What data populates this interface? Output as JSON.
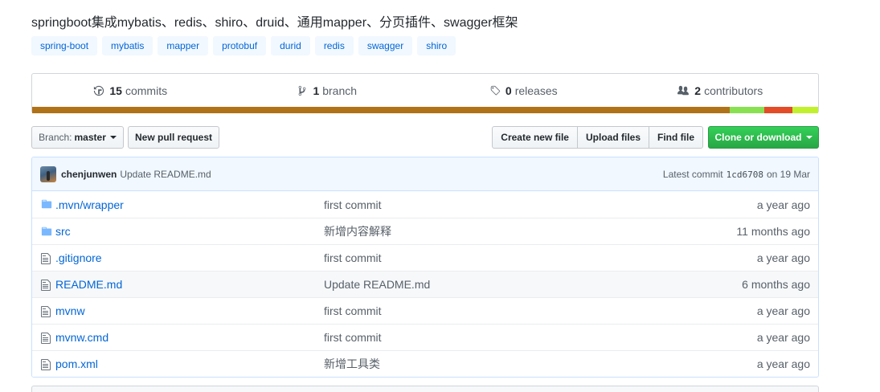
{
  "repo": {
    "description": "springboot集成mybatis、redis、shiro、druid、通用mapper、分页插件、swagger框架",
    "topics": [
      "spring-boot",
      "mybatis",
      "mapper",
      "protobuf",
      "durid",
      "redis",
      "swagger",
      "shiro"
    ]
  },
  "summary": {
    "commits_count": "15",
    "commits_label": "commits",
    "branches_count": "1",
    "branches_label": "branch",
    "releases_count": "0",
    "releases_label": "releases",
    "contributors_count": "2",
    "contributors_label": "contributors"
  },
  "language_bar": [
    {
      "color": "#b07219",
      "share": 88.8
    },
    {
      "color": "#89e051",
      "share": 4.3
    },
    {
      "color": "#e34c26",
      "share": 3.6
    },
    {
      "color": "#c1f12e",
      "share": 3.3
    }
  ],
  "toolbar": {
    "branch_label": "Branch:",
    "branch_value": "master",
    "new_pr": "New pull request",
    "create_file": "Create new file",
    "upload_files": "Upload files",
    "find_file": "Find file",
    "clone": "Clone or download"
  },
  "latest_commit": {
    "author": "chenjunwen",
    "message": "Update README.md",
    "prefix": "Latest commit",
    "sha": "1cd6708",
    "date": "on 19 Mar"
  },
  "files": [
    {
      "name": ".mvn/wrapper",
      "type": "dir",
      "message": "first commit",
      "age": "a year ago"
    },
    {
      "name": "src",
      "type": "dir",
      "message": "新增内容解释",
      "age": "11 months ago"
    },
    {
      "name": ".gitignore",
      "type": "file",
      "message": "first commit",
      "age": "a year ago"
    },
    {
      "name": "README.md",
      "type": "file",
      "message": "Update README.md",
      "age": "6 months ago"
    },
    {
      "name": "mvnw",
      "type": "file",
      "message": "first commit",
      "age": "a year ago"
    },
    {
      "name": "mvnw.cmd",
      "type": "file",
      "message": "first commit",
      "age": "a year ago"
    },
    {
      "name": "pom.xml",
      "type": "file",
      "message": "新增工具类",
      "age": "a year ago"
    }
  ],
  "icons": {
    "commits": "history-icon",
    "branch": "git-branch-icon",
    "releases": "tag-icon",
    "contributors": "people-icon",
    "directory": "folder-icon",
    "file": "file-icon"
  }
}
